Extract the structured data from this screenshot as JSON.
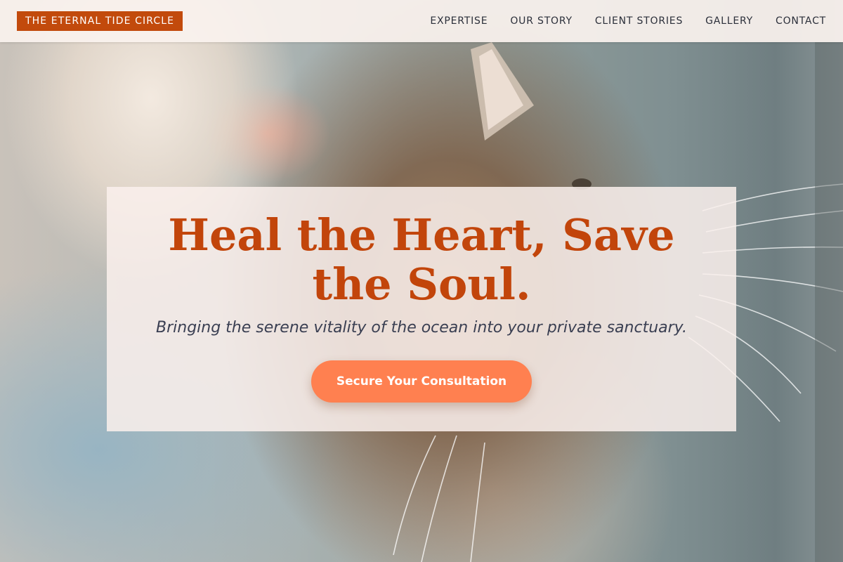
{
  "header": {
    "logo_text": "THE ETERNAL TIDE CIRCLE",
    "nav": [
      {
        "label": "EXPERTISE"
      },
      {
        "label": "OUR STORY"
      },
      {
        "label": "CLIENT STORIES"
      },
      {
        "label": "GALLERY"
      },
      {
        "label": "CONTACT"
      }
    ]
  },
  "hero": {
    "headline": "Heal the Heart, Save the Soul.",
    "subtitle": "Bringing the serene vitality of the ocean into your private sanctuary.",
    "cta_label": "Secure Your Consultation",
    "background_subject": "cat-photo"
  },
  "colors": {
    "accent": "#c2450b",
    "cta": "#ff8050",
    "nav_text": "#2b2f3a",
    "header_bg": "#faf2ee"
  }
}
